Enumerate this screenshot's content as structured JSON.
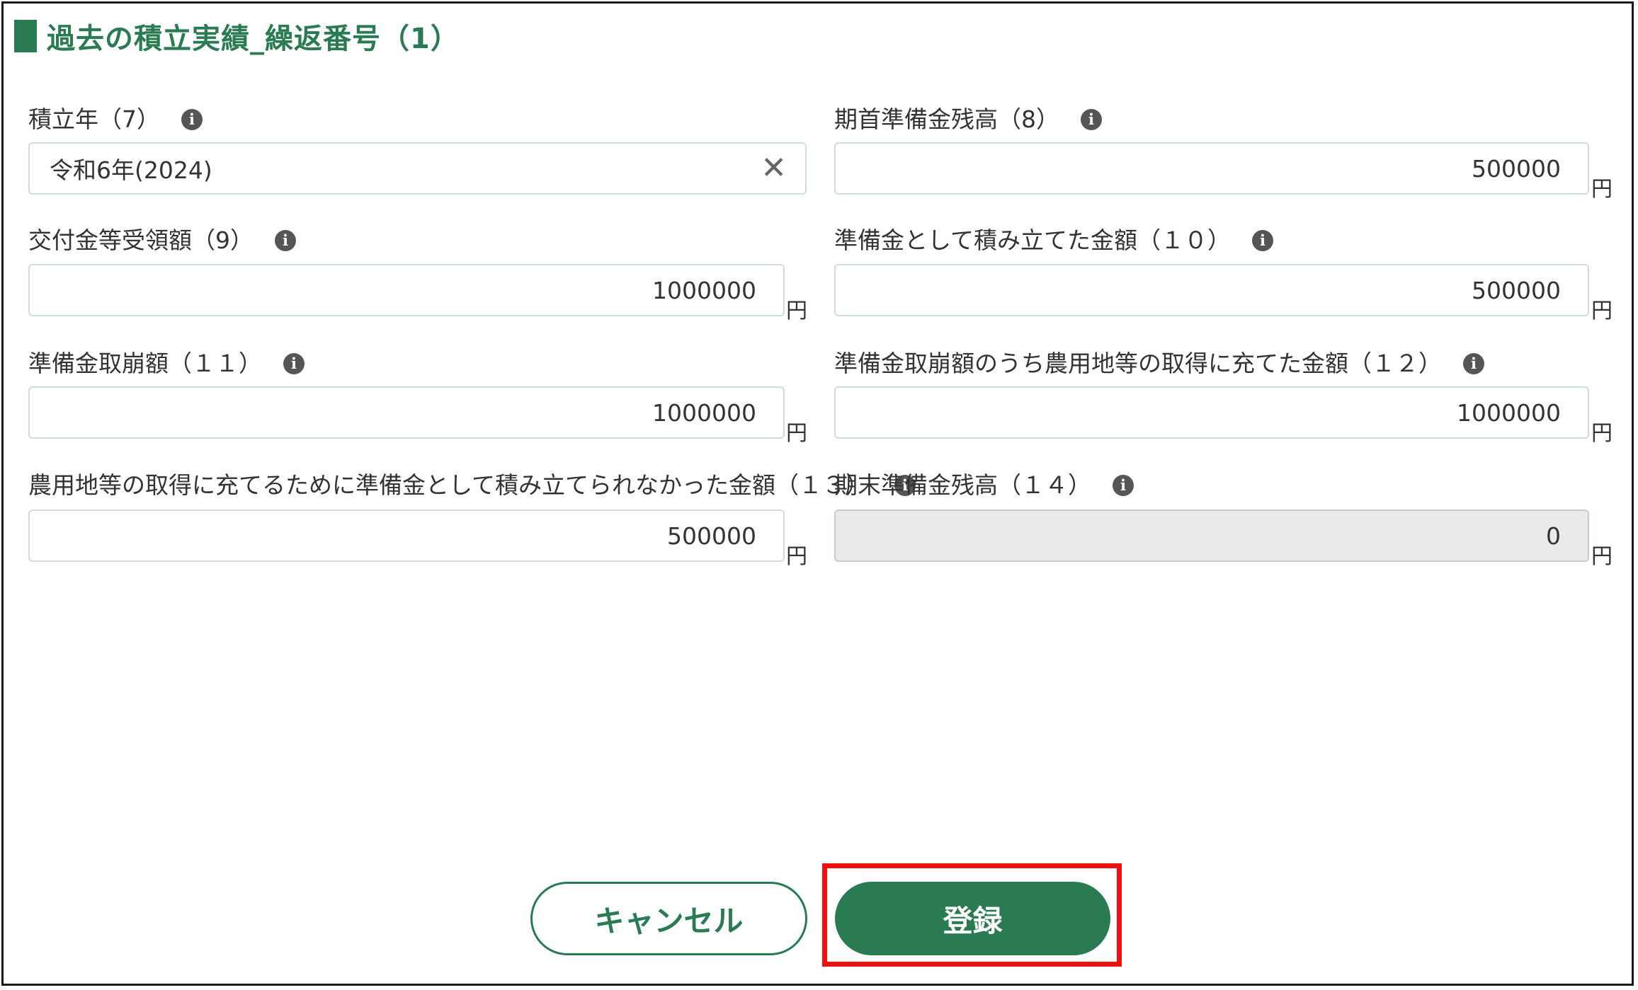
{
  "section": {
    "title": "過去の積立実績_繰返番号（1）"
  },
  "fields": {
    "f7": {
      "label": "積立年（7）",
      "value": "令和6年(2024)"
    },
    "f8": {
      "label": "期首準備金残高（8）",
      "value": "500000",
      "unit": "円"
    },
    "f9": {
      "label": "交付金等受領額（9）",
      "value": "1000000",
      "unit": "円"
    },
    "f10": {
      "label": "準備金として積み立てた金額（１０）",
      "value": "500000",
      "unit": "円"
    },
    "f11": {
      "label": "準備金取崩額（１１）",
      "value": "1000000",
      "unit": "円"
    },
    "f12": {
      "label": "準備金取崩額のうち農用地等の取得に充てた金額（１２）",
      "value": "1000000",
      "unit": "円"
    },
    "f13": {
      "label": "農用地等の取得に充てるために準備金として積み立てられなかった金額（１３）",
      "value": "500000",
      "unit": "円"
    },
    "f14": {
      "label": "期末準備金残高（１４）",
      "value": "0",
      "unit": "円"
    }
  },
  "icons": {
    "info": "i",
    "clear": "✕"
  },
  "buttons": {
    "cancel_label": "キャンセル",
    "register_label": "登録"
  },
  "colors": {
    "accent": "#2a7a52",
    "highlight": "#ee1111",
    "readonly_bg": "#e9eaeb"
  }
}
